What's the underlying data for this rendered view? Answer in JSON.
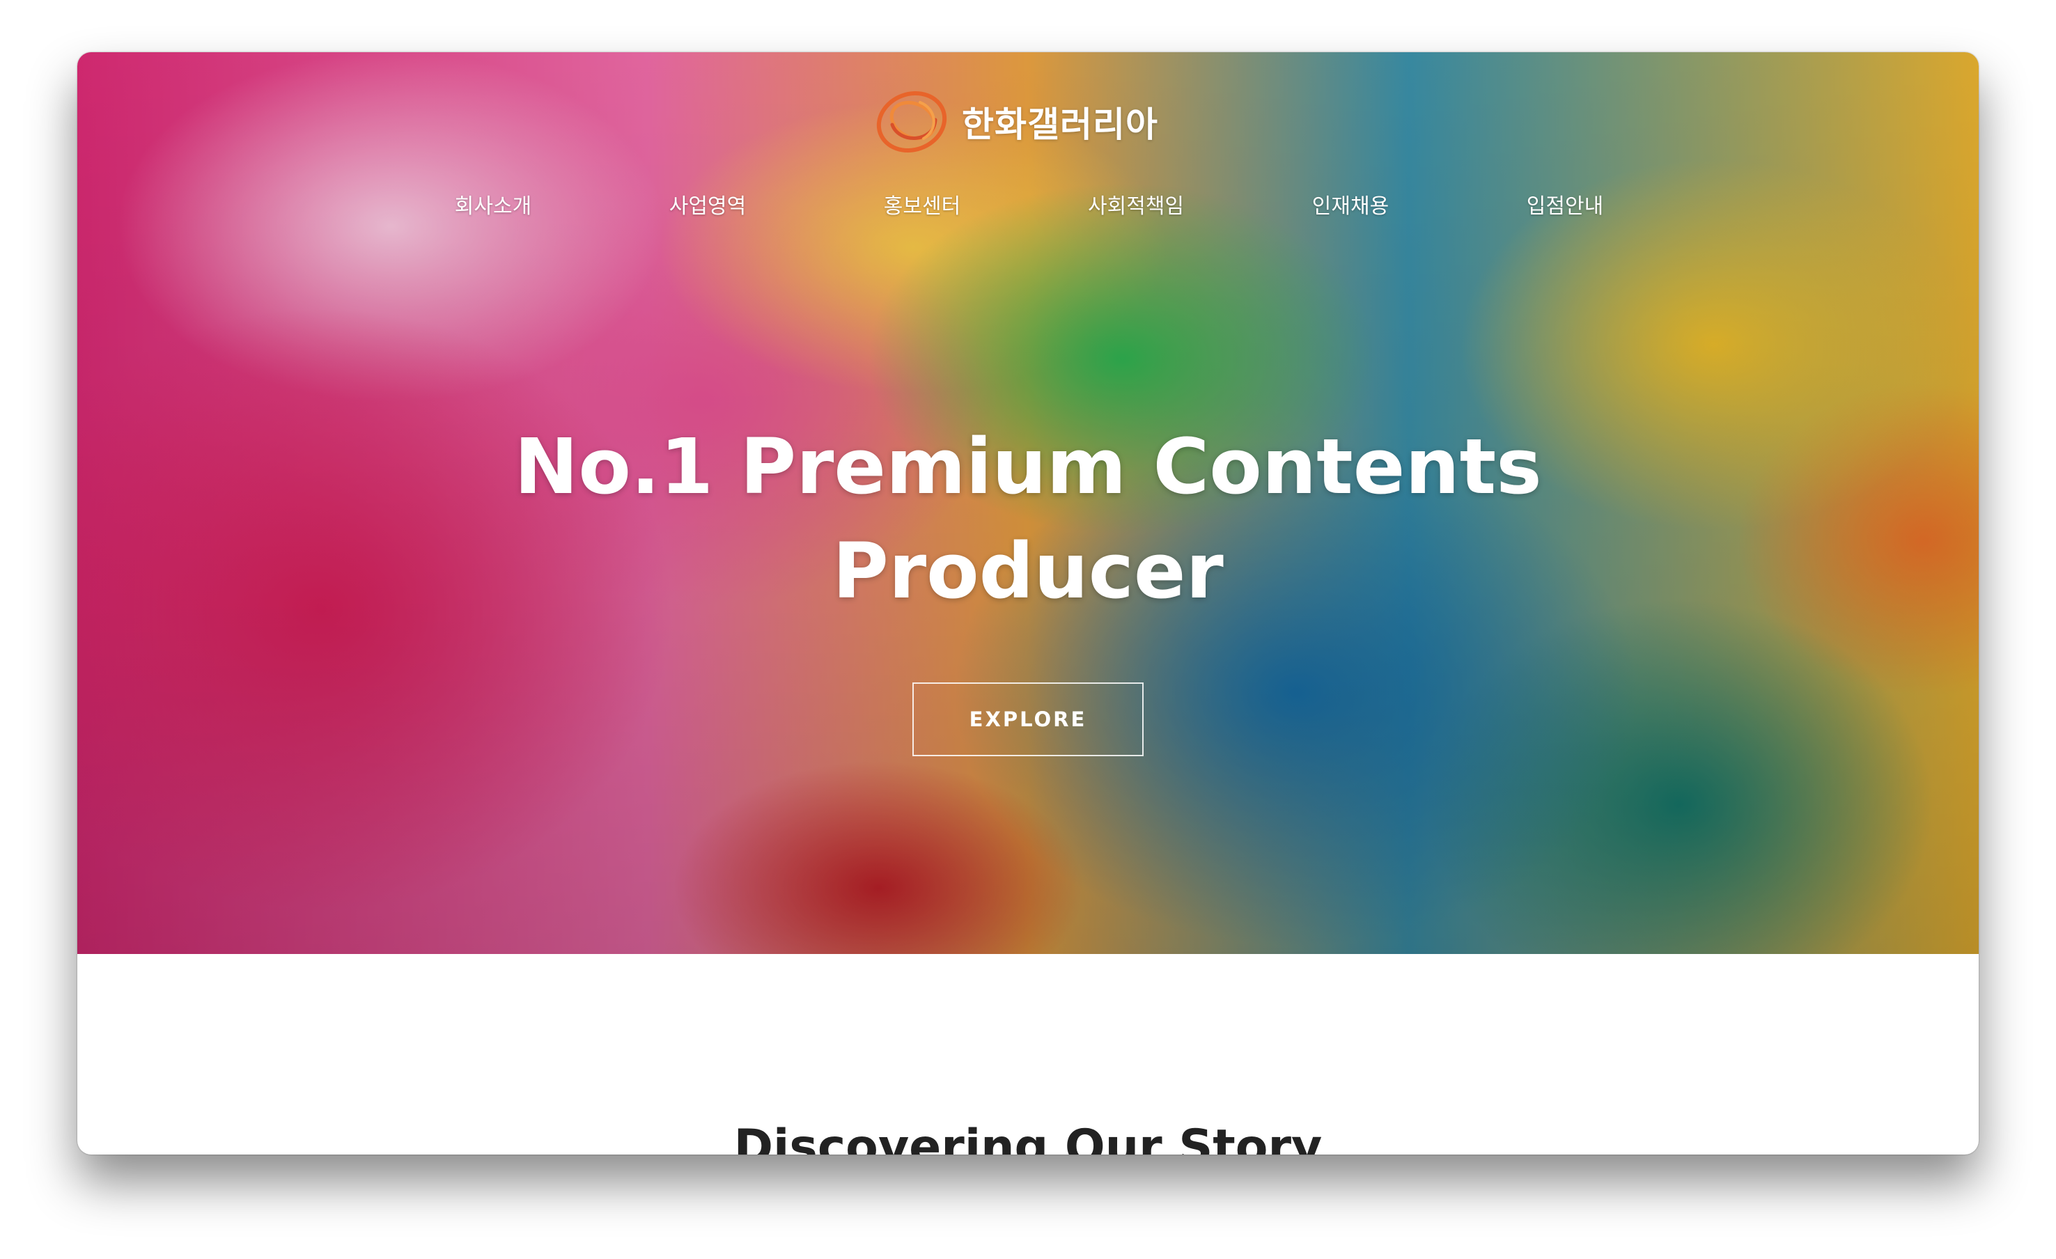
{
  "brand": {
    "logo_icon": "swirl-ring-icon",
    "name": "한화갤러리아",
    "logo_color": "#e8642a"
  },
  "nav": {
    "items": [
      {
        "label": "회사소개"
      },
      {
        "label": "사업영역"
      },
      {
        "label": "홍보센터"
      },
      {
        "label": "사회적책임"
      },
      {
        "label": "인재채용"
      },
      {
        "label": "입점안내"
      }
    ]
  },
  "hero": {
    "headline_line1": "No.1 Premium Contents",
    "headline_line2": "Producer",
    "cta_label": "EXPLORE"
  },
  "story": {
    "title": "Discovering Our Story"
  }
}
